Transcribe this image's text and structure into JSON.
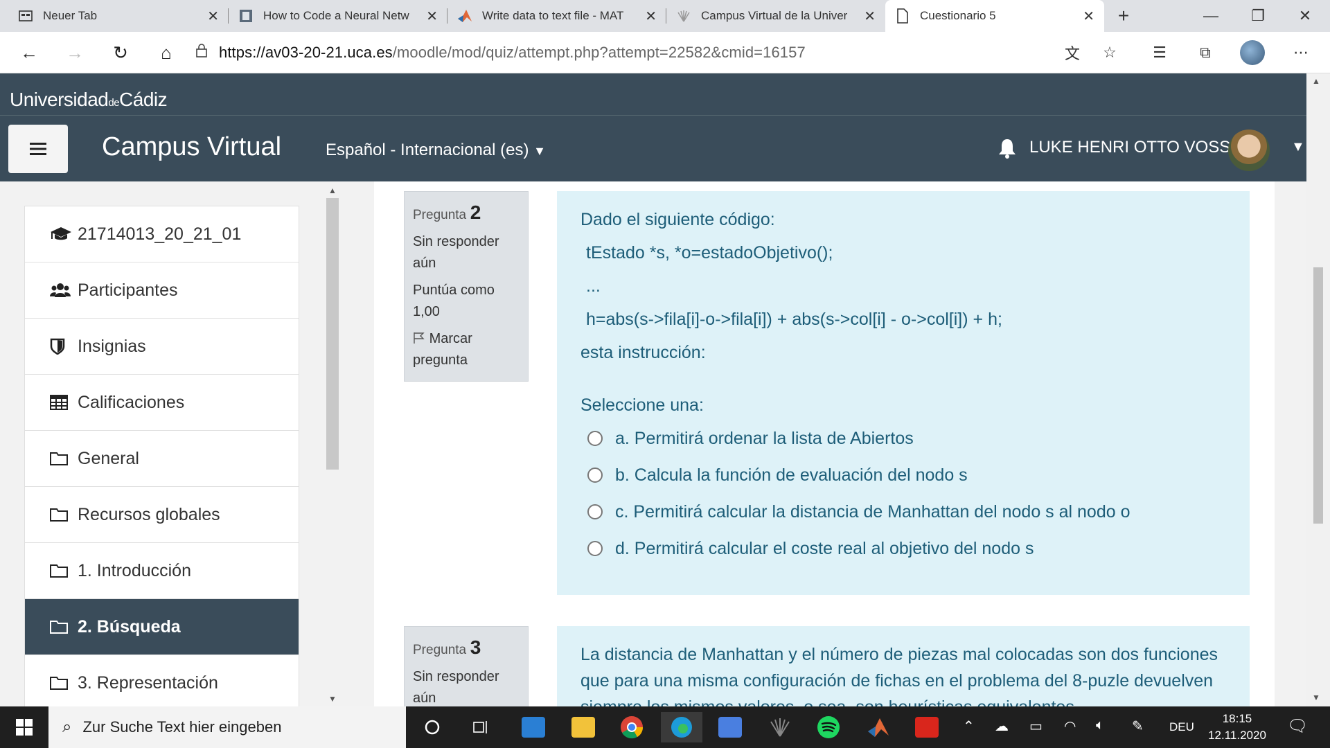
{
  "browser": {
    "tabs": [
      {
        "label": "Neuer Tab",
        "icon": "newtab-icon"
      },
      {
        "label": "How to Code a Neural Netw",
        "icon": "page-thumb-icon"
      },
      {
        "label": "Write data to text file - MAT",
        "icon": "matlab-icon"
      },
      {
        "label": "Campus Virtual de la Univer",
        "icon": "uca-icon"
      },
      {
        "label": "Cuestionario 5",
        "icon": "document-icon",
        "active": true
      }
    ],
    "url_host": "https://av03-20-21.uca.es",
    "url_path": "/moodle/mod/quiz/attempt.php?attempt=22582&cmid=16157"
  },
  "site": {
    "university_pre": "Universidad",
    "university_de": "de",
    "university_post": "Cádiz",
    "name": "Campus Virtual",
    "language": "Español - Internacional (es)",
    "user_name": "LUKE HENRI OTTO VOSS"
  },
  "nav": {
    "items": [
      {
        "label": "21714013_20_21_01",
        "icon": "graduation-cap-icon"
      },
      {
        "label": "Participantes",
        "icon": "users-icon"
      },
      {
        "label": "Insignias",
        "icon": "shield-icon"
      },
      {
        "label": "Calificaciones",
        "icon": "table-icon"
      },
      {
        "label": "General",
        "icon": "folder-icon"
      },
      {
        "label": "Recursos globales",
        "icon": "folder-icon"
      },
      {
        "label": "1. Introducción",
        "icon": "folder-icon"
      },
      {
        "label": "2. Búsqueda",
        "icon": "folder-icon",
        "active": true
      },
      {
        "label": "3. Representación",
        "icon": "folder-icon"
      }
    ]
  },
  "questions": [
    {
      "label": "Pregunta",
      "number": "2",
      "state": "Sin responder aún",
      "grade": "Puntúa como 1,00",
      "flag": "Marcar pregunta",
      "text_intro": "Dado el siguiente código:",
      "code_line1": "tEstado *s, *o=estadoObjetivo();",
      "code_ellipsis": "...",
      "code_line2": "h=abs(s->fila[i]-o->fila[i]) + abs(s->col[i] - o->col[i]) + h;",
      "text_outro": "esta instrucción:",
      "prompt": "Seleccione una:",
      "options": [
        "a. Permitirá ordenar la lista de Abiertos",
        "b. Calcula la función de evaluación del nodo s",
        "c. Permitirá calcular la distancia de Manhattan del nodo s al nodo o",
        "d. Permitirá calcular el coste real al objetivo del nodo s"
      ]
    },
    {
      "label": "Pregunta",
      "number": "3",
      "state": "Sin responder aún",
      "text": "La distancia de Manhattan y el número de piezas mal colocadas son dos funciones que para una misma configuración de fichas en el problema del 8-puzle devuelven siempre los mismos valores, o sea, son heurísticas equivalentes"
    }
  ],
  "taskbar": {
    "search_placeholder": "Zur Suche Text hier eingeben",
    "language": "DEU",
    "time": "18:15",
    "date": "12.11.2020"
  }
}
